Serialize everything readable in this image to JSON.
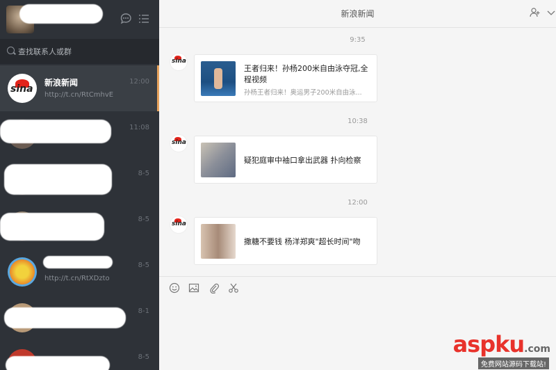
{
  "sidebar": {
    "search_placeholder": "查找联系人或群",
    "chats": [
      {
        "name": "新浪新闻",
        "preview": "http://t.cn/RtCmhvE",
        "time": "12:00",
        "active": true
      },
      {
        "name": "",
        "preview": "",
        "time": "11:08"
      },
      {
        "name": "",
        "preview": "",
        "time": "8-5"
      },
      {
        "name": "",
        "preview": "",
        "time": "8-5"
      },
      {
        "name": "",
        "preview": "http://t.cn/RtXDzto",
        "time": "8-5"
      },
      {
        "name": "",
        "preview": "",
        "time": "8-1"
      },
      {
        "name": "",
        "preview": "",
        "time": "8-5"
      }
    ]
  },
  "main": {
    "title": "新浪新闻",
    "messages": [
      {
        "time": "9:35",
        "title": "王者归来！孙杨200米自由泳夺冠,全程视频",
        "desc": "孙杨王者归来！奥运男子200米自由泳..."
      },
      {
        "time": "10:38",
        "title": "疑犯庭审中袖口拿出武器 扑向检察",
        "desc": ""
      },
      {
        "time": "12:00",
        "title": "撒糖不要钱 杨洋郑爽\"超长时间\"吻",
        "desc": ""
      }
    ]
  },
  "watermark": {
    "brand": "aspku",
    "tld": ".com",
    "sub": "免费网站源码下载站!"
  },
  "colors": {
    "sidebar_bg": "#2e3238",
    "active_accent": "#e6a25c",
    "sina_red": "#e2231a",
    "watermark_red": "#e8322b"
  },
  "icons": [
    "chat-bubble-icon",
    "menu-list-icon",
    "search-icon",
    "add-member-icon",
    "chevron-down-icon",
    "emoji-icon",
    "image-icon",
    "attachment-icon",
    "scissors-icon"
  ]
}
